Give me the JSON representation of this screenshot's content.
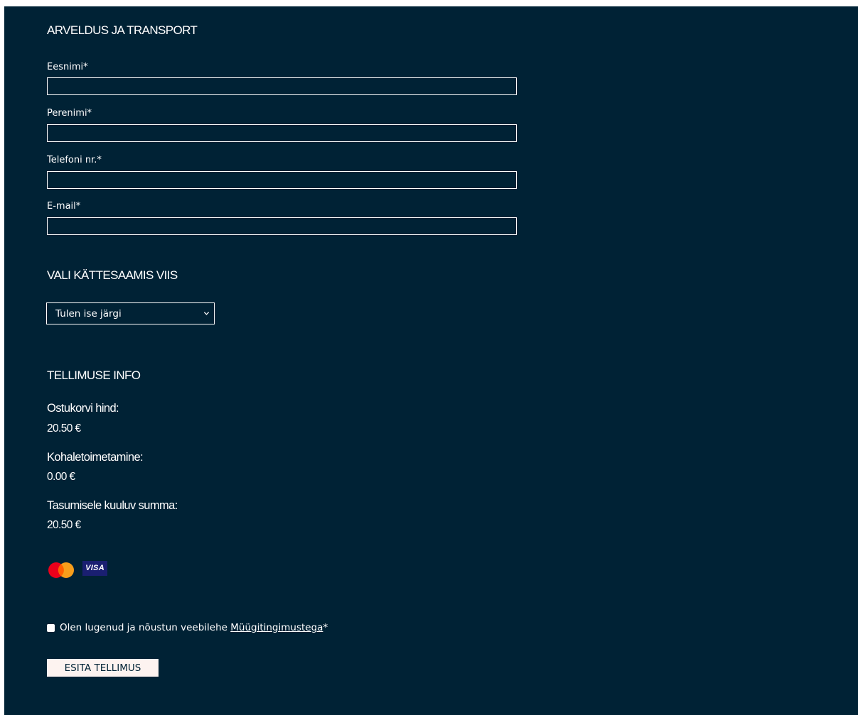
{
  "billing": {
    "title": "ARVELDUS JA TRANSPORT",
    "fields": [
      {
        "label": "Eesnimi*",
        "value": ""
      },
      {
        "label": "Perenimi*",
        "value": ""
      },
      {
        "label": "Telefoni nr.*",
        "value": ""
      },
      {
        "label": "E-mail*",
        "value": ""
      }
    ]
  },
  "delivery": {
    "title": "VALI KÄTTESAAMIS VIIS",
    "selected": "Tulen ise järgi",
    "chevron_icon": "chevron-down-icon"
  },
  "order_info": {
    "title": "TELLIMUSE INFO",
    "cart_price_label": "Ostukorvi hind:",
    "cart_price_value": "20.50 €",
    "shipping_label": "Kohaletoimetamine:",
    "shipping_value": "0.00 €",
    "total_label": "Tasumisele kuuluv summa:",
    "total_value": "20.50 €"
  },
  "payment_methods": [
    {
      "name": "mastercard-icon",
      "colors": [
        "#eb001b",
        "#f79e1b",
        "#ff5f00"
      ]
    },
    {
      "name": "visa-icon",
      "text": "VISA",
      "color": "#1a1f71"
    }
  ],
  "terms": {
    "checked": false,
    "text_before": "Olen lugenud ja nõustun veebilehe ",
    "link_text": "Müügitingimustega",
    "text_after": "*"
  },
  "submit": {
    "label": "ESITA TELLIMUS"
  },
  "colors": {
    "background": "#002235",
    "text": "#ffffff",
    "button_bg": "#fdf3f0",
    "button_text": "#002235"
  }
}
